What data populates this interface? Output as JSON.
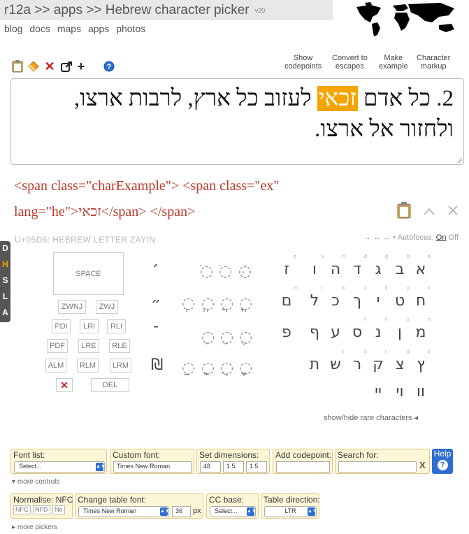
{
  "header": {
    "title": "r12a >> apps >> Hebrew character picker",
    "version": "v20",
    "nav": [
      "blog",
      "docs",
      "maps",
      "apps",
      "photos"
    ]
  },
  "toolbar": {
    "icons": [
      "clipboard-icon",
      "eraser-icon",
      "clear-icon",
      "share-icon",
      "plus-icon",
      "help-icon"
    ],
    "right_buttons": [
      [
        "Show",
        "codepoints"
      ],
      [
        "Convert to",
        "escapes"
      ],
      [
        "Make",
        "example"
      ],
      [
        "Character",
        "markup"
      ]
    ]
  },
  "editor": {
    "line1_pre": "2. כל אדם ",
    "line1_hl": "זכאי",
    "line1_post": " לעזוב כל ארץ, לרבות ארצו,",
    "line2": "ולחזור אל ארצו."
  },
  "markup": {
    "line1": "<span class=\"charExample\"> <span class=\"ex\"",
    "line2": "lang=\"he\">זכאי</span> </span>"
  },
  "char_info": {
    "codepoint": "U+05D6: HEBREW LETTER ZAYIN",
    "autofocus_label": "→ ↔ ← • Autofocus:",
    "on": "On",
    "off": "Off"
  },
  "side_tabs": [
    "D",
    "H",
    "S",
    "L",
    "A"
  ],
  "controls_keys": {
    "space": "SPACE",
    "zwnj": "ZWNJ",
    "zwj": "ZWJ",
    "row1": [
      "PDI",
      "LRI",
      "RLI"
    ],
    "row2": [
      "PDF",
      "LRE",
      "RLE"
    ],
    "row3": [
      "ALM",
      "RLM",
      "LRM"
    ],
    "delete_icon": "✕",
    "del": "DEL"
  },
  "punct": [
    "׳",
    "״",
    "־",
    "₪"
  ],
  "points": [
    [
      "ֹ",
      "ֺ",
      "ּ"
    ],
    [
      "ְ",
      "ֱ",
      "ֲ",
      "ֳ"
    ],
    [
      "ִ",
      "ֵ",
      "ֶ"
    ],
    [
      "ַ",
      "ָ",
      "ֻ",
      "ׇ"
    ]
  ],
  "letters": {
    "row1": [
      "א",
      "ב",
      "ג",
      "ד",
      "ה",
      "ו",
      "ז"
    ],
    "row1_sup": [
      "a",
      "b",
      "g",
      "d",
      "h",
      "v",
      "z"
    ],
    "row2": [
      "ח",
      "ט",
      "י",
      "ך",
      "כ",
      "ל",
      "ם"
    ],
    "row2_sup": [
      "x",
      "y",
      "k",
      "x",
      "k",
      "l",
      "m"
    ],
    "row3": [
      "מ",
      "ן",
      "נ",
      "ס",
      "ע",
      "ף",
      "פ"
    ],
    "row3_sup": [
      "n",
      "s",
      "f",
      "f"
    ],
    "row4": [
      "ץ",
      "צ",
      "ק",
      "ר",
      "ש",
      "ת"
    ],
    "row4_sup": [
      "c",
      "q",
      "r",
      "s",
      "t"
    ],
    "row5": [
      "וו",
      "וי",
      "יי"
    ]
  },
  "rare_label": "show/hide rare characters",
  "bottom": {
    "font_list": {
      "label": "Font list:",
      "value": "Select..."
    },
    "custom_font": {
      "label": "Custom font:",
      "value": "Times New Roman"
    },
    "dimensions": {
      "label": "Set dimensions:",
      "values": [
        "48",
        "1.5",
        "1.5"
      ]
    },
    "add_codepoint": {
      "label": "Add codepoint:",
      "value": ""
    },
    "search": {
      "label": "Search for:",
      "value": "",
      "clear": "X"
    },
    "help": "Help",
    "more_controls": "more controls",
    "normalise": {
      "label": "Normalise:",
      "nfc": "NFC",
      "buttons": [
        "NFC",
        "NFD",
        "No"
      ]
    },
    "table_font": {
      "label": "Change table font:",
      "value": "Times New Roman",
      "size": "36",
      "unit": "px"
    },
    "cc_base": {
      "label": "CC base:",
      "value": "Select..."
    },
    "direction": {
      "label": "Table direction:",
      "value": "LTR"
    },
    "more_pickers": "more pickers"
  }
}
